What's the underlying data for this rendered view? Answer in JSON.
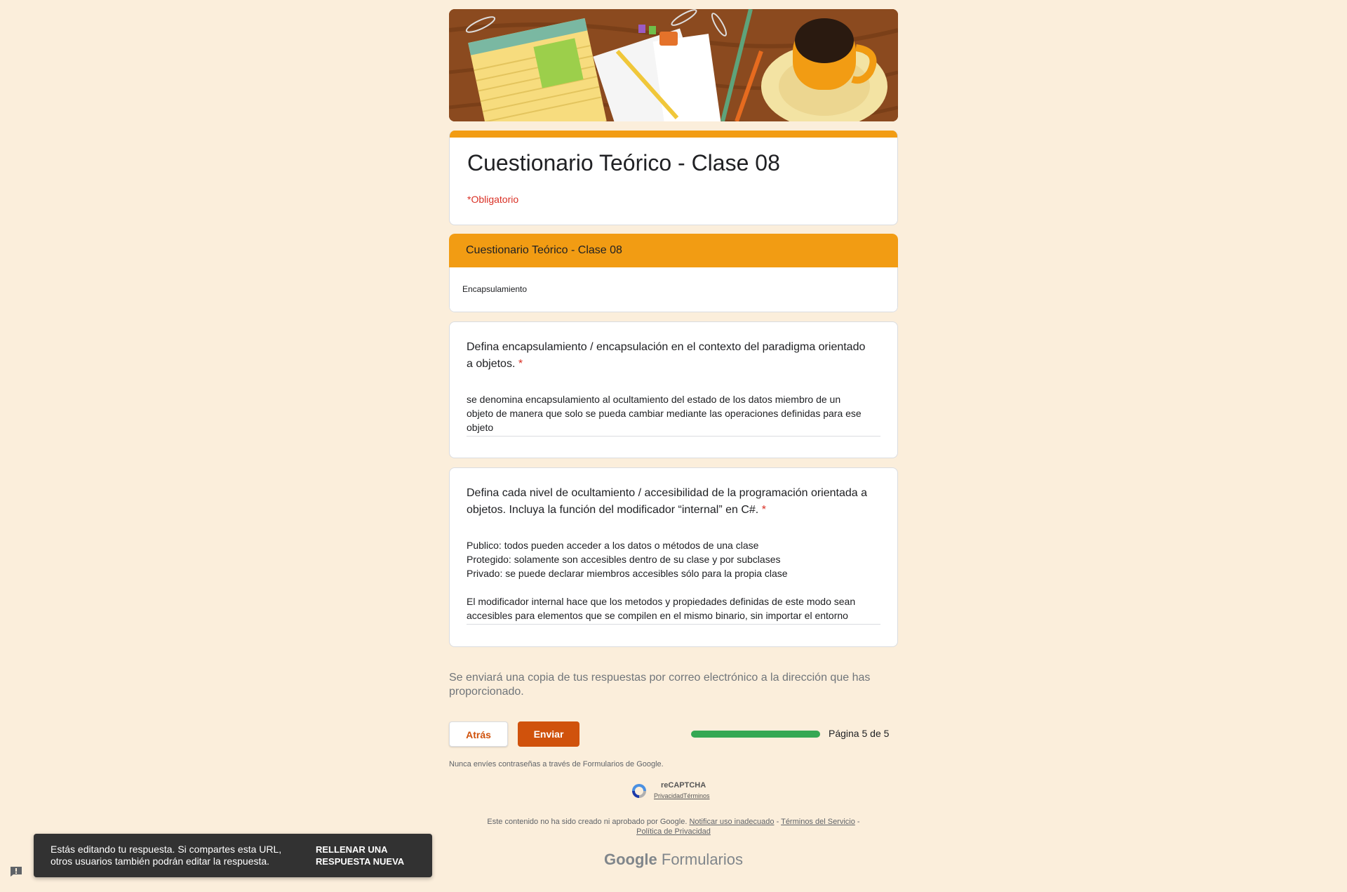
{
  "form": {
    "title": "Cuestionario Teórico - Clase 08",
    "required_note": "*Obligatorio"
  },
  "section": {
    "title": "Cuestionario Teórico - Clase 08",
    "description": "Encapsulamiento"
  },
  "questions": [
    {
      "text": "Defina encapsulamiento / encapsulación en el contexto del paradigma orientado\na objetos.",
      "required_mark": "*",
      "answer": "se denomina encapsulamiento al ocultamiento del estado de los datos miembro de un\nobjeto de manera que solo se pueda cambiar mediante las operaciones definidas para ese\nobjeto"
    },
    {
      "text": "Defina cada nivel de ocultamiento / accesibilidad de la programación orientada a\nobjetos. Incluya la función del modificador “internal” en C#.",
      "required_mark": "*",
      "answer": "Publico: todos pueden acceder a los datos o métodos de una clase\nProtegido: solamente son accesibles dentro de su clase y por subclases\nPrivado: se puede declarar miembros accesibles sólo para la propia clase\n\nEl modificador internal hace que los metodos y propiedades definidas de este modo sean\naccesibles para elementos que se compilen en el mismo binario, sin importar el entorno"
    }
  ],
  "copy_note": "Se enviará una copia de tus respuestas por correo electrónico a la dirección que has\nproporcionado.",
  "nav": {
    "back_label": "Atrás",
    "submit_label": "Enviar",
    "page_label": "Página 5 de 5",
    "progress": 1.0
  },
  "password_note": "Nunca envíes contraseñas a través de Formularios de Google.",
  "recaptcha": {
    "title": "reCAPTCHA",
    "privacy": "Privacidad",
    "terms": "Términos"
  },
  "footer": {
    "text": "Este contenido no ha sido creado ni aprobado por Google.",
    "report": "Notificar uso inadecuado",
    "tos": "Términos del Servicio",
    "privacy": "Política de Privacidad",
    "sep": " - "
  },
  "brand": {
    "google": "Google",
    "product": "Formularios"
  },
  "snackbar": {
    "message": "Estás editando tu respuesta. Si compartes esta URL,\notros usuarios también podrán editar la respuesta.",
    "action": "RELLENAR UNA\nRESPUESTA NUEVA"
  },
  "colors": {
    "page_bg": "#fbeedb",
    "accent": "#f29c13",
    "button": "#d0520c",
    "progress": "#34a853",
    "required": "#d93025"
  },
  "icons": [
    "recaptcha-logo-icon",
    "feedback-icon"
  ]
}
